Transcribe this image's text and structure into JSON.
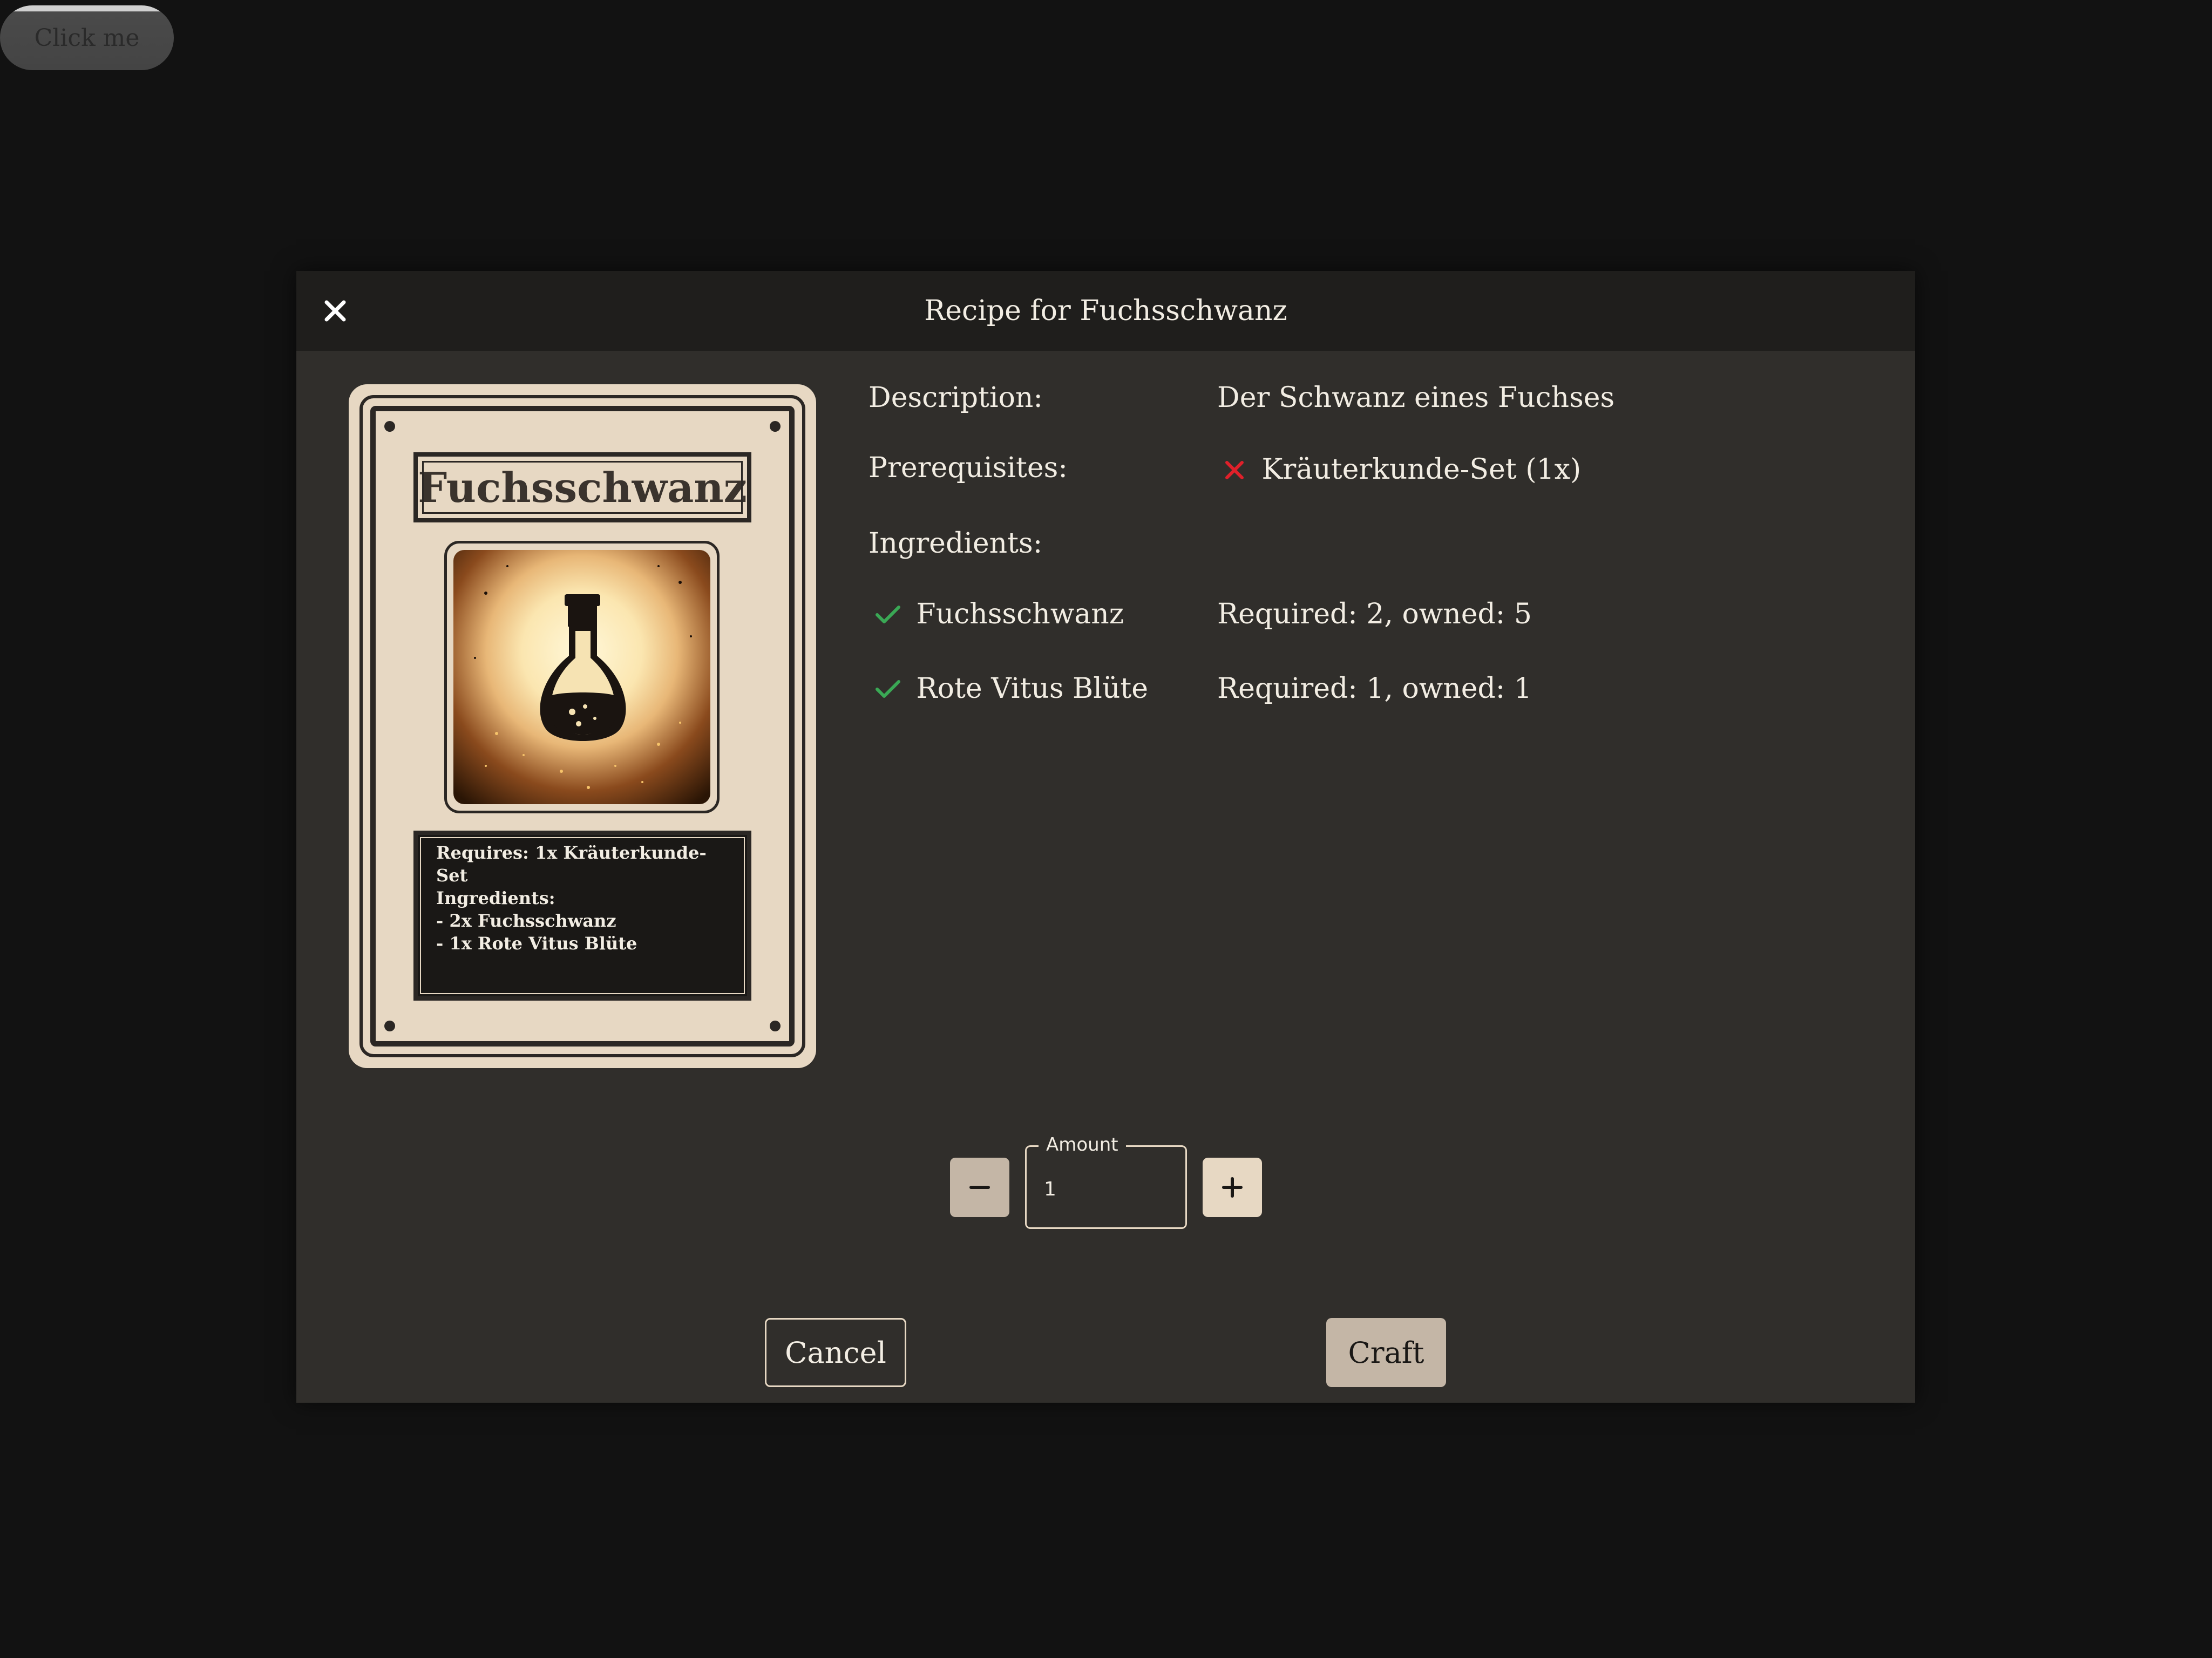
{
  "top_button": {
    "label": "Click me"
  },
  "modal": {
    "title": "Recipe for Fuchsschwanz",
    "card": {
      "name": "Fuchsschwanz",
      "text_lines": [
        "Requires: 1x Kräuterkunde-Set",
        "Ingredients:",
        "- 2x Fuchsschwanz",
        "- 1x Rote Vitus Blüte"
      ]
    },
    "description_label": "Description:",
    "description_value": "Der Schwanz eines Fuchses",
    "prerequisites_label": "Prerequisites:",
    "prerequisites": [
      {
        "name": "Kräuterkunde-Set (1x)",
        "met": false
      }
    ],
    "ingredients_label": "Ingredients:",
    "ingredients": [
      {
        "name": "Fuchsschwanz",
        "status": "Required: 2, owned: 5",
        "met": true
      },
      {
        "name": "Rote Vitus Blüte",
        "status": "Required: 1, owned: 1",
        "met": true
      }
    ],
    "amount": {
      "label": "Amount",
      "value": "1"
    },
    "cancel_label": "Cancel",
    "craft_label": "Craft",
    "colors": {
      "ok": "#3aa855",
      "fail": "#e0202a",
      "accent": "#c4b6a6"
    }
  }
}
